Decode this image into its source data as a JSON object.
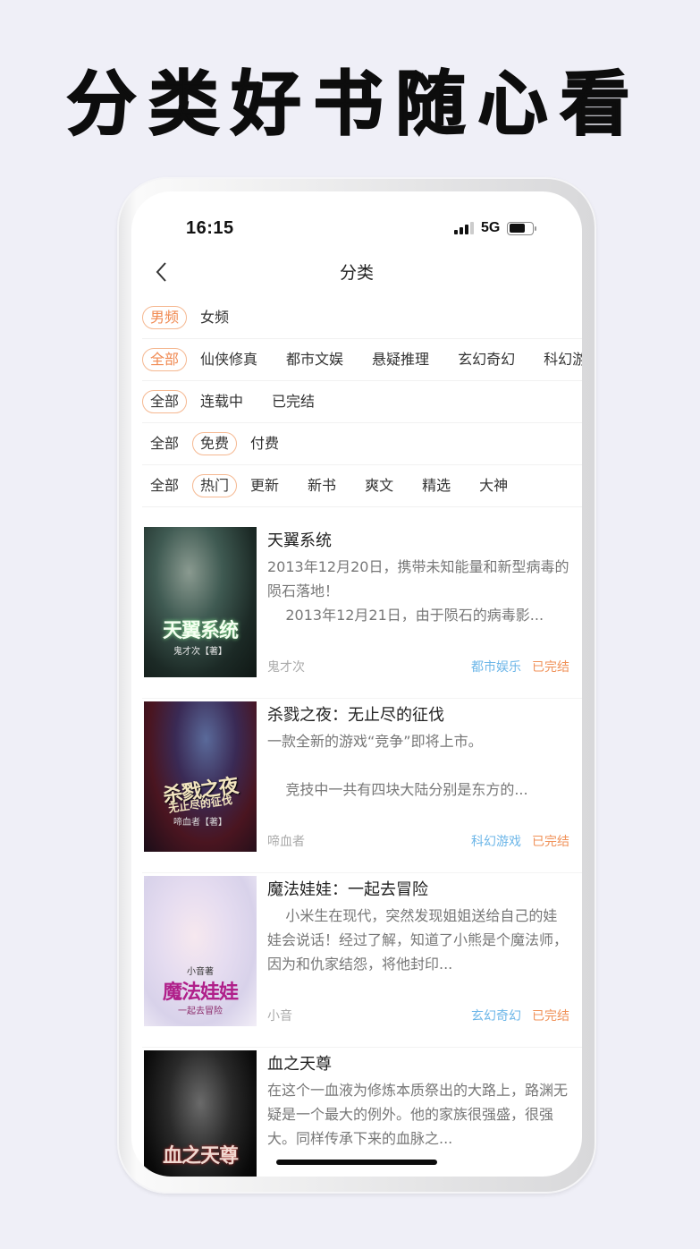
{
  "promo": {
    "headline": "分类好书随心看"
  },
  "status_bar": {
    "time": "16:15",
    "network": "5G",
    "battery_level": 0.7,
    "signal_bars": 3,
    "signal_bars_total": 4
  },
  "nav": {
    "back_icon": "chevron-left-icon",
    "title": "分类"
  },
  "colors": {
    "accent_orange": "#f08a52",
    "accent_border": "#f5b891",
    "genre_blue": "#6cb6e8",
    "background": "#efeff7"
  },
  "filters": {
    "gender": {
      "options": [
        "男频",
        "女频"
      ],
      "selected": "男频"
    },
    "category": {
      "options": [
        "全部",
        "仙侠修真",
        "都市文娱",
        "悬疑推理",
        "玄幻奇幻",
        "科幻游戏"
      ],
      "selected": "全部"
    },
    "serial_status": {
      "options": [
        "全部",
        "连载中",
        "已完结"
      ],
      "selected": "全部"
    },
    "price": {
      "options": [
        "全部",
        "免费",
        "付费"
      ],
      "selected": "免费"
    },
    "sort": {
      "options": [
        "全部",
        "热门",
        "更新",
        "新书",
        "爽文",
        "精选",
        "大神"
      ],
      "selected": "热门"
    }
  },
  "books": [
    {
      "title": "天翼系统",
      "description": "2013年12月20日，携带未知能量和新型病毒的陨石落地！\n    2013年12月21日，由于陨石的病毒影...",
      "author": "鬼才次",
      "genre": "都市娱乐",
      "status": "已完结",
      "cover": {
        "title": "天翼系统",
        "byline": "鬼才次【著】"
      }
    },
    {
      "title": "杀戮之夜：无止尽的征伐",
      "description": "一款全新的游戏“竞争”即将上市。\n\n    竞技中一共有四块大陆分别是东方的...",
      "author": "啼血者",
      "genre": "科幻游戏",
      "status": "已完结",
      "cover": {
        "title": "杀戮之夜",
        "subtitle": "无止尽的征伐",
        "byline": "啼血者【著】"
      }
    },
    {
      "title": "魔法娃娃：一起去冒险",
      "description": "    小米生在现代，突然发现姐姐送给自己的娃娃会说话！经过了解，知道了小熊是个魔法师，因为和仇家结怨，将他封印...",
      "author": "小音",
      "genre": "玄幻奇幻",
      "status": "已完结",
      "cover": {
        "title": "魔法娃娃",
        "subtitle": "一起去冒险",
        "byline": "小音著"
      }
    },
    {
      "title": "血之天尊",
      "description": "在这个一血液为修炼本质祭出的大路上，路渊无疑是一个最大的例外。他的家族很强盛，很强大。同样传承下来的血脉之...",
      "author": "",
      "genre": "",
      "status": "",
      "cover": {
        "title": "血之天尊"
      }
    }
  ]
}
